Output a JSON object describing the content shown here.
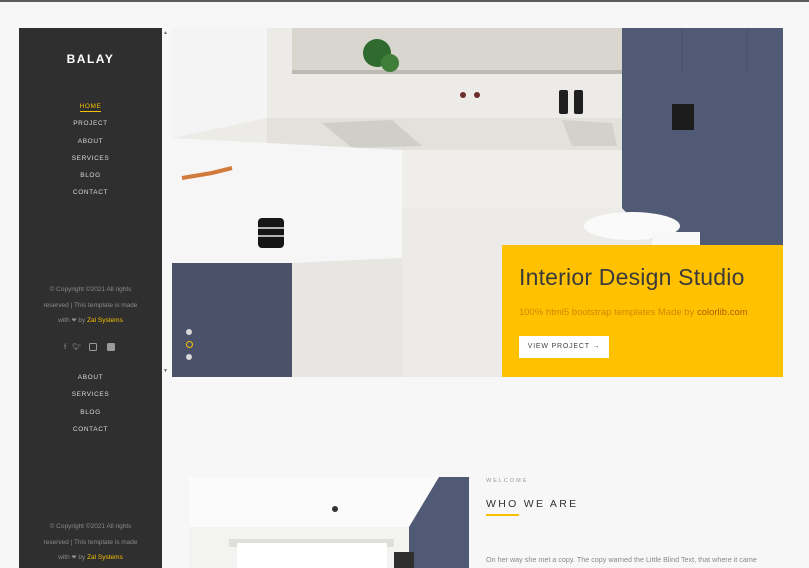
{
  "sidebar": {
    "logo": "BALAY",
    "nav": [
      "HOME",
      "PROJECT",
      "ABOUT",
      "SERVICES",
      "BLOG",
      "CONTACT"
    ],
    "active_nav": "HOME",
    "copyright": {
      "line1": "© Copyright ©2021 All rights",
      "line2": "reserved | This template is made",
      "line3_prefix": "with",
      "line3_by": "by",
      "brand": "Zal Systems"
    },
    "social_icons": [
      "facebook-icon",
      "twitter-icon",
      "instagram-icon",
      "linkedin-icon"
    ],
    "nav_repeat": [
      "ABOUT",
      "SERVICES",
      "BLOG",
      "CONTACT"
    ]
  },
  "hero": {
    "title": "Interior Design Studio",
    "subtitle_text": "100% html5 bootstrap templates Made by",
    "subtitle_link": "colorlib.com",
    "button_label": "VIEW PROJECT",
    "button_arrow": "→",
    "slide_count": 3,
    "active_slide": 2
  },
  "about": {
    "eyebrow": "WELCOME",
    "heading": "WHO WE ARE",
    "paragraph": "On her way she met a copy. The copy warned the Little Blind Text, that where it came"
  },
  "colors": {
    "accent": "#ffc100",
    "sidebar_bg": "#2f2f2f"
  }
}
